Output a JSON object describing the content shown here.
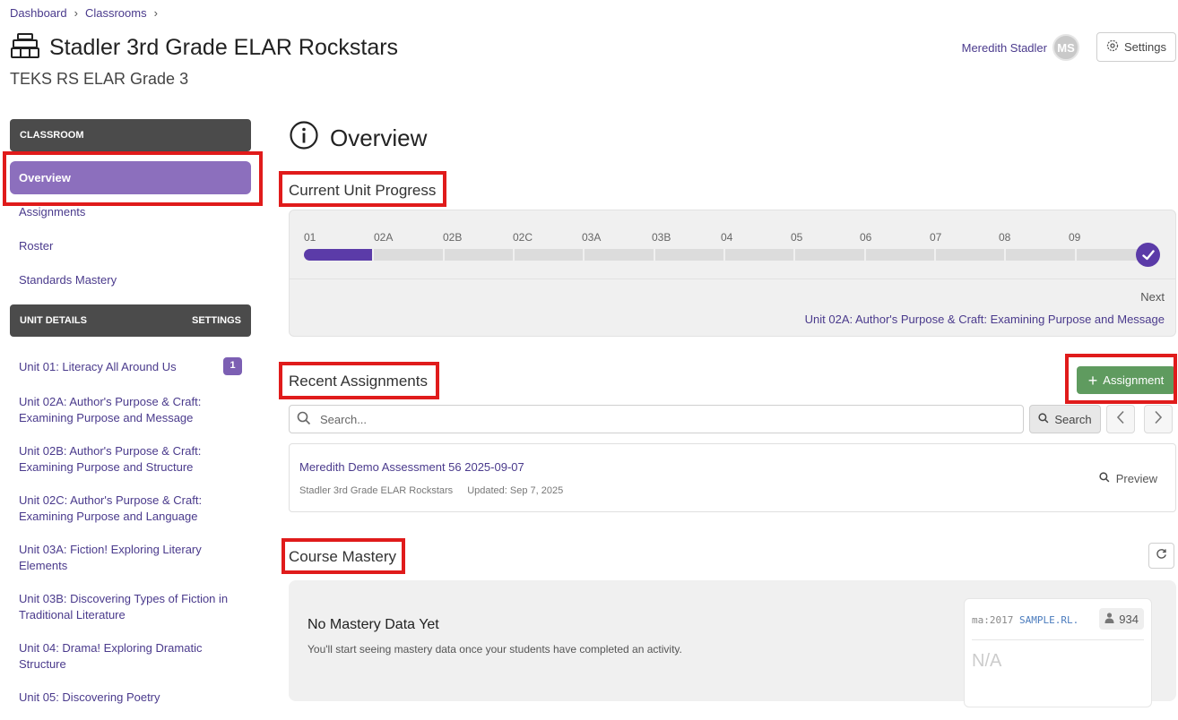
{
  "breadcrumb": {
    "items": [
      "Dashboard",
      "Classrooms"
    ]
  },
  "header": {
    "title": "Stadler 3rd Grade ELAR Rockstars",
    "subtitle": "TEKS RS ELAR Grade 3",
    "user_name": "Meredith Stadler",
    "user_initials": "MS",
    "settings_label": "Settings"
  },
  "sidebar": {
    "classroom_header": "CLASSROOM",
    "nav": [
      "Overview",
      "Assignments",
      "Roster",
      "Standards Mastery"
    ],
    "unit_header": "UNIT DETAILS",
    "unit_settings": "SETTINGS",
    "units": [
      "Unit 01: Literacy All Around Us",
      "Unit 02A: Author's Purpose & Craft: Examining Purpose and Message",
      "Unit 02B: Author's Purpose & Craft: Examining Purpose and Structure",
      "Unit 02C: Author's Purpose & Craft: Examining Purpose and Language",
      "Unit 03A: Fiction! Exploring Literary Elements",
      "Unit 03B: Discovering Types of Fiction in Traditional Literature",
      "Unit 04: Drama! Exploring Dramatic Structure",
      "Unit 05: Discovering Poetry"
    ],
    "unit01_badge": "1"
  },
  "overview": {
    "title": "Overview",
    "progress_title": "Current Unit Progress",
    "units": [
      "01",
      "02A",
      "02B",
      "02C",
      "03A",
      "03B",
      "04",
      "05",
      "06",
      "07",
      "08",
      "09"
    ],
    "completed_segments": 1,
    "next_label": "Next",
    "next_unit": "Unit 02A: Author's Purpose & Craft: Examining Purpose and Message"
  },
  "recent": {
    "title": "Recent Assignments",
    "add_button": "Assignment",
    "search_placeholder": "Search...",
    "search_button": "Search",
    "assignment": {
      "title": "Meredith Demo Assessment 56 2025-09-07",
      "classroom": "Stadler 3rd Grade ELAR Rockstars",
      "updated": "Updated: Sep 7, 2025",
      "preview": "Preview"
    }
  },
  "mastery": {
    "title": "Course Mastery",
    "empty_title": "No Mastery Data Yet",
    "empty_desc": "You'll start seeing mastery data once your students have completed an activity.",
    "code_prefix": "ma:2017",
    "code_std": "SAMPLE.RL.",
    "count": "934",
    "value": "N/A"
  },
  "colors": {
    "accent": "#5b3ba8",
    "active_nav": "#8c6fbd",
    "add_button": "#5f9b5f",
    "highlight": "#e01b1b"
  }
}
